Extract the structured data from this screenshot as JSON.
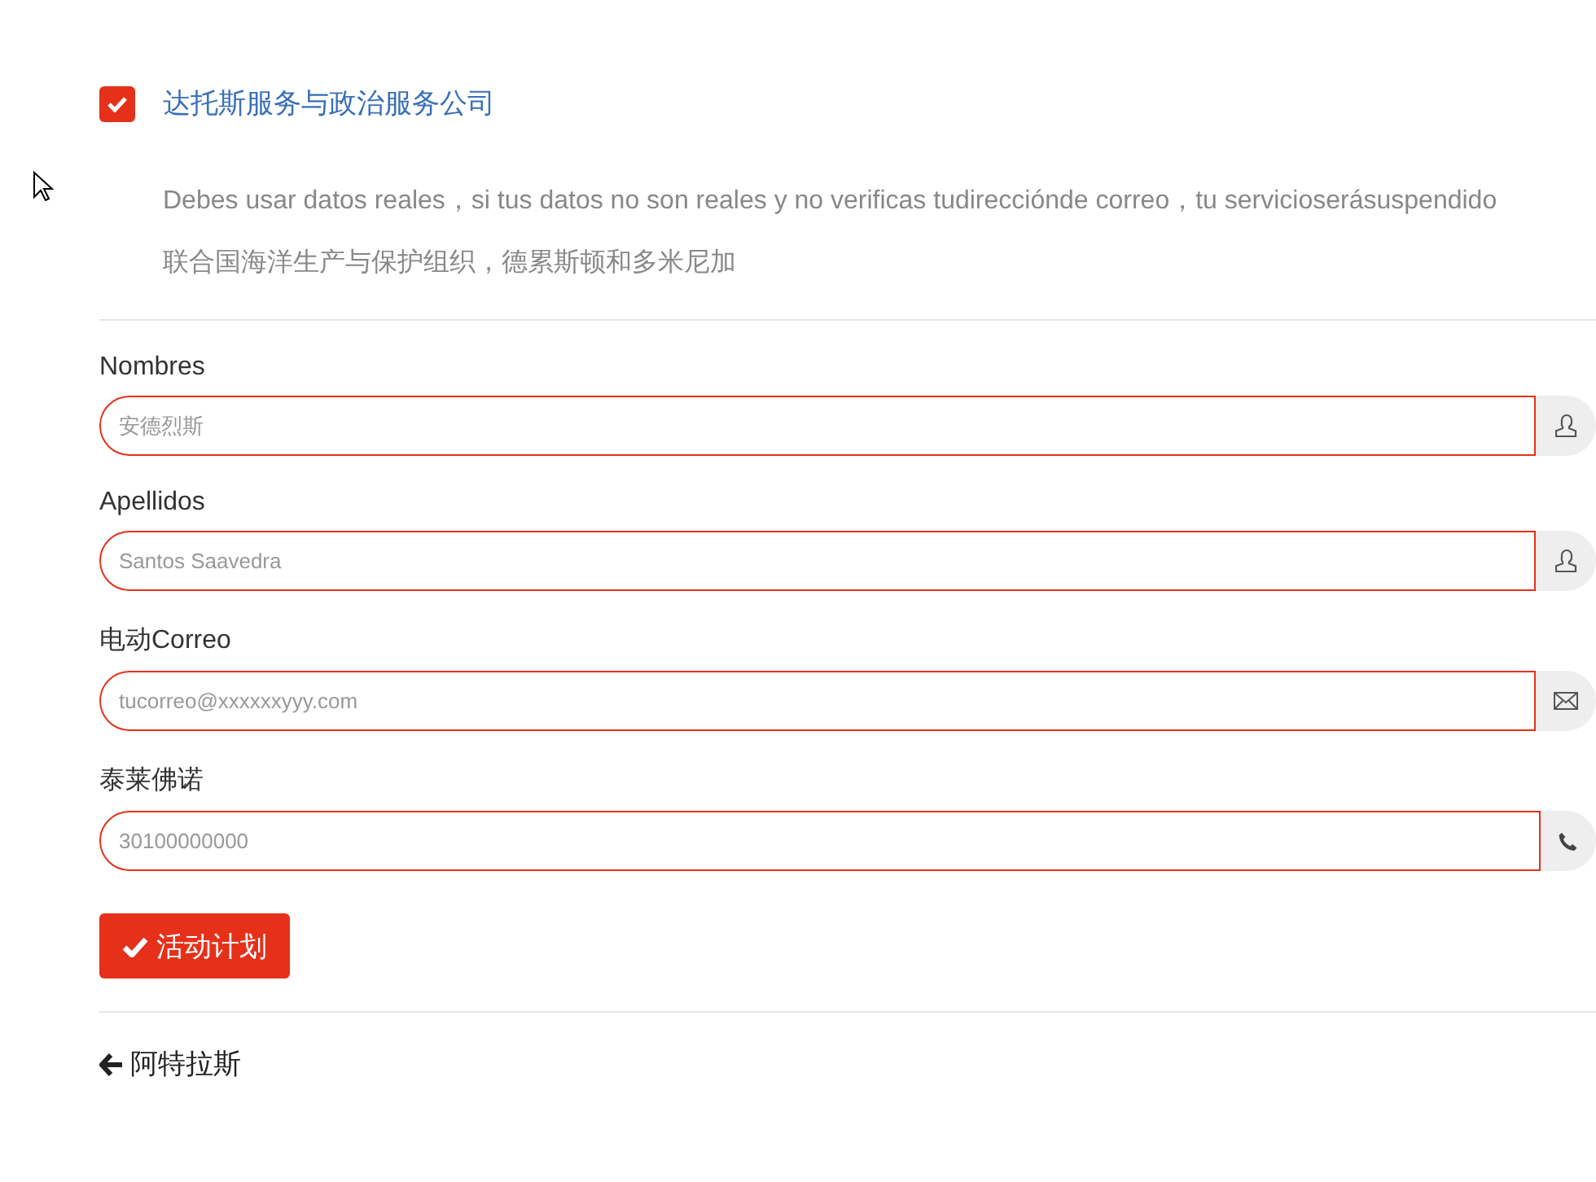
{
  "agreement": {
    "checked": true,
    "label": "达托斯服务与政治服务公司"
  },
  "notice": [
    "Debes usar datos reales，si tus datos no son reales y no verificas tudirecciónde correo，tu servicioserásuspendido",
    "联合国海洋生产与保护组织，德累斯顿和多米尼加"
  ],
  "fields": [
    {
      "label": "Nombres",
      "placeholder": "安德烈斯",
      "kind": "person"
    },
    {
      "label": "Apellidos",
      "placeholder": "Santos Saavedra",
      "kind": "person"
    },
    {
      "label": "电动Correo",
      "placeholder": "tucorreo@xxxxxxyyy.com",
      "kind": "email"
    },
    {
      "label": "泰莱佛诺",
      "placeholder": "30100000000",
      "kind": "phone"
    }
  ],
  "submit_button": {
    "label": "活动计划"
  },
  "back_link": {
    "label": "阿特拉斯"
  }
}
